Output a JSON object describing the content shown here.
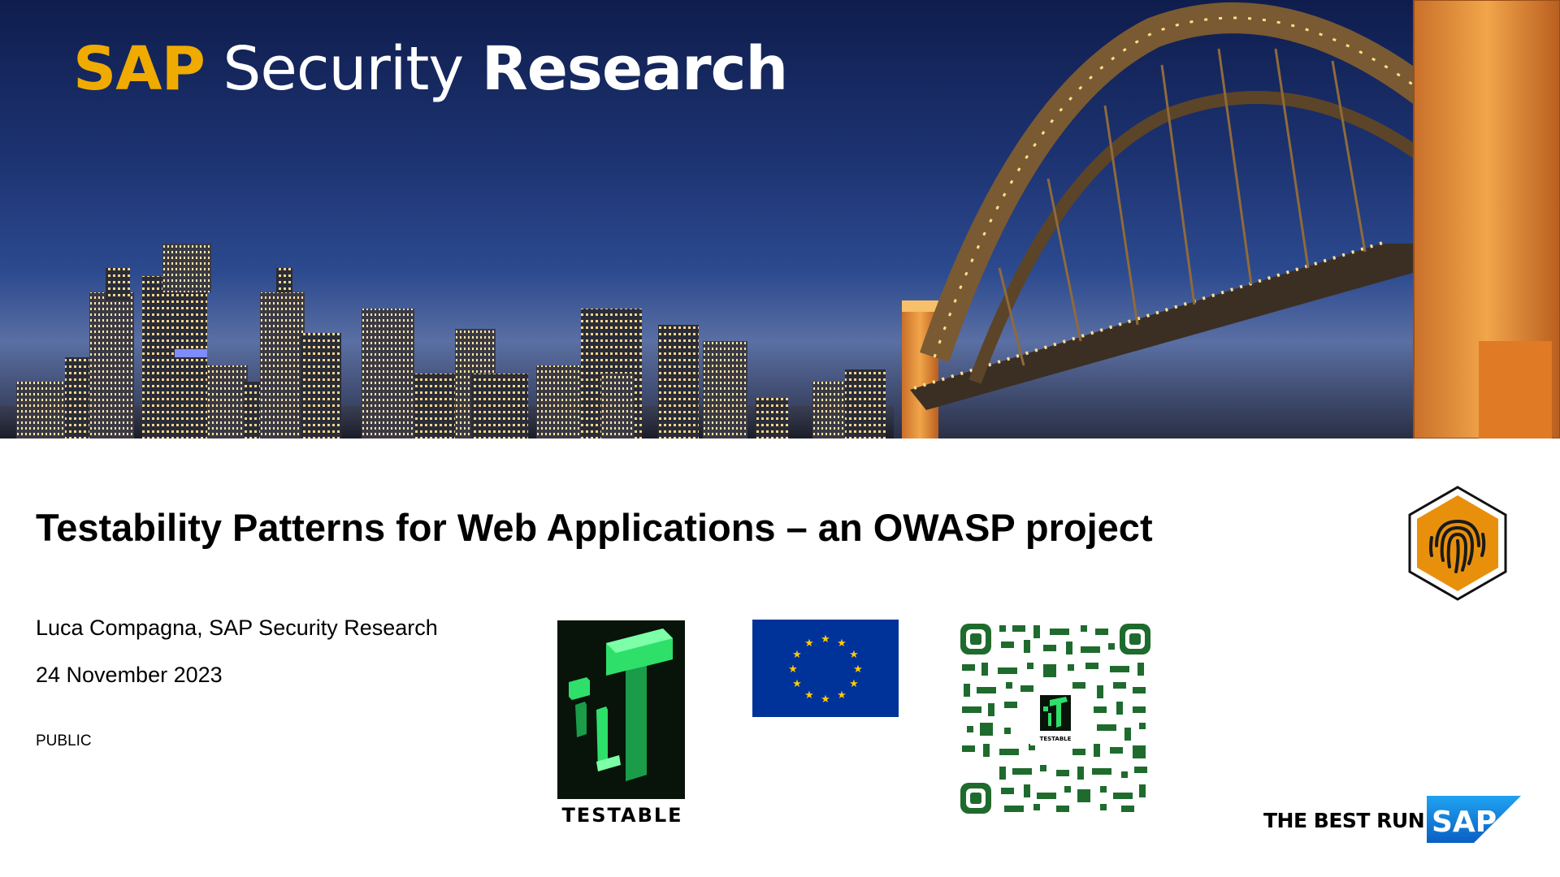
{
  "header": {
    "brand_sap": "SAP",
    "brand_security": "Security",
    "brand_research": "Research"
  },
  "slide": {
    "title": "Testability Patterns for Web Applications – an OWASP project",
    "author": "Luca Compagna, SAP Security Research",
    "date": "24 November 2023",
    "classification": "PUBLIC"
  },
  "logos": {
    "testable_label": "TESTABLE",
    "qr_center_label": "TESTABLE",
    "tagline": "THE BEST RUN",
    "sap_logo_text": "SAP"
  },
  "colors": {
    "sap_gold": "#f0ab00",
    "sap_blue": "#0a6ed1",
    "eu_blue": "#003399",
    "eu_star": "#ffcc00",
    "testable_green": "#2ee06a",
    "qr_green": "#1f6b2e",
    "badge_orange": "#e8900c"
  },
  "icons": [
    "fingerprint-icon",
    "eu-flag-icon",
    "qr-code-icon",
    "testable-logo-icon",
    "sap-logo-icon"
  ]
}
